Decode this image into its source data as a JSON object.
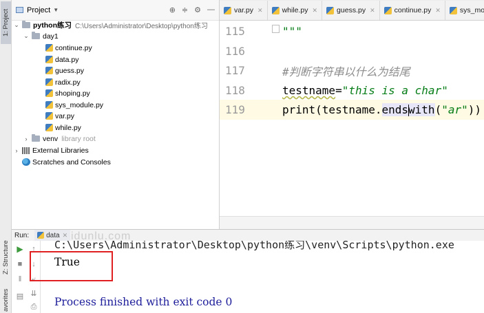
{
  "tool_strip": {
    "project_tab": "1: Project",
    "structure_tab": "Z: Structure",
    "favorites_tab": "avorites"
  },
  "project_panel": {
    "title": "Project",
    "tree": {
      "root": {
        "name": "python练习",
        "path": "C:\\Users\\Administrator\\Desktop\\python练习"
      },
      "day1": "day1",
      "files": [
        "continue.py",
        "data.py",
        "guess.py",
        "radix.py",
        "shoping.py",
        "sys_module.py",
        "var.py",
        "while.py"
      ],
      "venv": {
        "name": "venv",
        "hint": "library root"
      },
      "external_libraries": "External Libraries",
      "scratches": "Scratches and Consoles"
    }
  },
  "editor": {
    "tabs": [
      "var.py",
      "while.py",
      "guess.py",
      "continue.py",
      "sys_module"
    ],
    "lines": [
      {
        "number": "115",
        "text": "\"\"\""
      },
      {
        "number": "116",
        "text": ""
      },
      {
        "number": "117",
        "text": "#判断字符串以什么为结尾"
      },
      {
        "number": "118",
        "name": "testname",
        "assign": "=",
        "value": "\"this is a char\""
      },
      {
        "number": "119",
        "call_pre": "print(testname.",
        "method_a": "ends",
        "method_b": "with",
        "arg_open": "(",
        "arg": "\"ar\"",
        "arg_close": "))"
      }
    ]
  },
  "run_panel": {
    "label": "Run:",
    "tab": "data",
    "watermark": "idunlu.com",
    "console": {
      "command": "C:\\Users\\Administrator\\Desktop\\python练习\\venv\\Scripts\\python.exe",
      "output": "True",
      "exit_message": "Process finished with exit code 0"
    }
  },
  "colors": {
    "highlight_box": "#e02020",
    "string": "#067d17",
    "comment": "#8c8c8c",
    "console_text": "#1d1d9b",
    "current_line": "#fffae3"
  }
}
